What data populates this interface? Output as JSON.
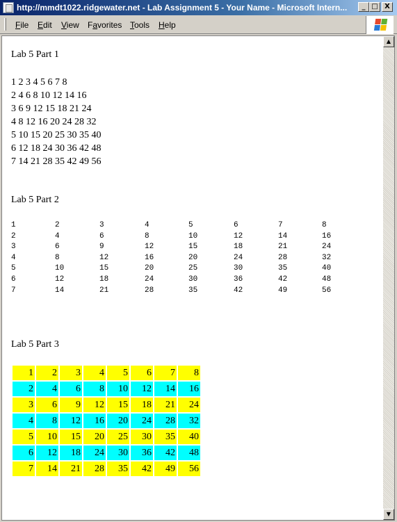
{
  "window": {
    "title": "http://mmdt1022.ridgewater.net - Lab Assignment 5 - Your Name - Microsoft Intern...",
    "minimize_label": "_",
    "maximize_label": "□",
    "close_label": "X"
  },
  "menu": [
    {
      "key": "F",
      "rest": "ile"
    },
    {
      "key": "E",
      "rest": "dit"
    },
    {
      "key": "V",
      "rest": "iew"
    },
    {
      "key": "a",
      "pre": "F",
      "rest": "vorites"
    },
    {
      "key": "T",
      "rest": "ools"
    },
    {
      "key": "H",
      "rest": "elp"
    }
  ],
  "scroll": {
    "up": "▲",
    "down": "▼"
  },
  "page": {
    "part1_title": "Lab 5 Part 1",
    "part2_title": "Lab 5 Part 2",
    "part3_title": "Lab 5 Part 3",
    "part1_rows": [
      "1 2 3 4 5 6 7 8",
      "2 4 6 8 10 12 14 16",
      "3 6 9 12 15 18 21 24",
      "4 8 12 16 20 24 28 32",
      "5 10 15 20 25 30 35 40",
      "6 12 18 24 30 36 42 48",
      "7 14 21 28 35 42 49 56"
    ],
    "table": [
      [
        "1",
        "2",
        "3",
        "4",
        "5",
        "6",
        "7",
        "8"
      ],
      [
        "2",
        "4",
        "6",
        "8",
        "10",
        "12",
        "14",
        "16"
      ],
      [
        "3",
        "6",
        "9",
        "12",
        "15",
        "18",
        "21",
        "24"
      ],
      [
        "4",
        "8",
        "12",
        "16",
        "20",
        "24",
        "28",
        "32"
      ],
      [
        "5",
        "10",
        "15",
        "20",
        "25",
        "30",
        "35",
        "40"
      ],
      [
        "6",
        "12",
        "18",
        "24",
        "30",
        "36",
        "42",
        "48"
      ],
      [
        "7",
        "14",
        "21",
        "28",
        "35",
        "42",
        "49",
        "56"
      ]
    ],
    "row_colors": [
      "#ffff00",
      "#00ffff"
    ]
  }
}
